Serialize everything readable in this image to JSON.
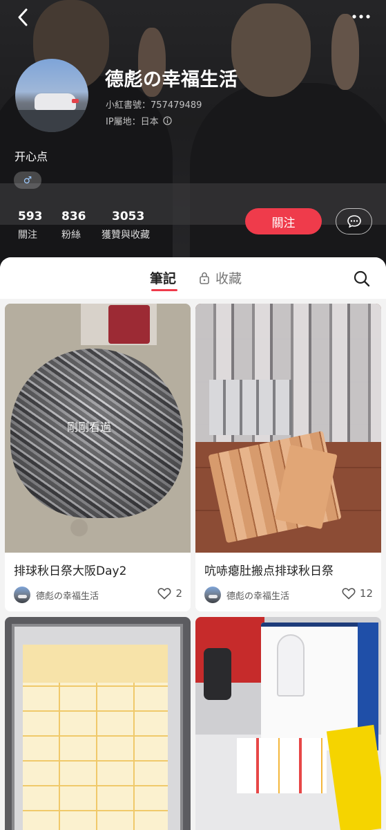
{
  "profile": {
    "username": "德彪の幸福生活",
    "redbook_id": "小紅書號：757479489",
    "ip_location": "IP屬地：日本",
    "bio": "开心点",
    "gender_symbol": "♂"
  },
  "stats": [
    {
      "value": "593",
      "label": "關注"
    },
    {
      "value": "836",
      "label": "粉絲"
    },
    {
      "value": "3053",
      "label": "獲贊與收藏"
    }
  ],
  "actions": {
    "follow_label": "關注"
  },
  "tabs": {
    "notes": "筆記",
    "favorites": "收藏"
  },
  "notes": [
    {
      "title": "排球秋日祭大阪Day2",
      "author": "德彪の幸福生活",
      "likes": "2",
      "badge": "剛剛看過"
    },
    {
      "title": "吭哧瘪肚搬点排球秋日祭",
      "author": "德彪の幸福生活",
      "likes": "12"
    }
  ],
  "colors": {
    "accent": "#ef3b4b",
    "header_bg": "#2e2e31",
    "sheet_bg": "#f3f3f3"
  }
}
